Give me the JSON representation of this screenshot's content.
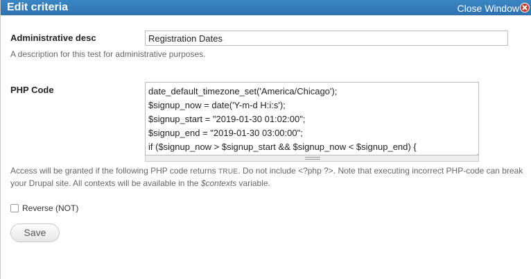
{
  "window": {
    "title": "Edit criteria",
    "close_label": "Close Window"
  },
  "admin_desc": {
    "label": "Administrative desc",
    "value": "Registration Dates",
    "description": "A description for this test for administrative purposes."
  },
  "php_code": {
    "label": "PHP Code",
    "lines": [
      "date_default_timezone_set('America/Chicago');",
      "$signup_now = date('Y-m-d H:i:s');",
      "$signup_start = \"2019-01-30 01:02:00\";",
      "$signup_end = \"2019-01-30 03:00:00\";",
      "if ($signup_now > $signup_start && $signup_now < $signup_end) {"
    ],
    "help_part1": "Access will be granted if the following PHP code returns ",
    "help_code": "TRUE",
    "help_part2": ". Do not include <?php ?>. Note that executing incorrect PHP-code can break your Drupal site. All contexts will be available in the ",
    "help_var": "$contexts",
    "help_part3": " variable."
  },
  "reverse": {
    "label": "Reverse (NOT)",
    "checked": false
  },
  "save_label": "Save",
  "colors": {
    "titlebar": "#2f78b6",
    "close_icon": "#c0392b"
  }
}
